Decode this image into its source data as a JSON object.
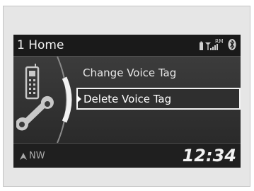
{
  "header": {
    "title": "1 Home"
  },
  "status": {
    "roaming_label": "RM"
  },
  "menu": {
    "items": [
      {
        "label": "Change Voice Tag",
        "selected": false
      },
      {
        "label": "Delete Voice Tag",
        "selected": true
      }
    ]
  },
  "footer": {
    "compass": "NW",
    "time": "12:34"
  },
  "icons": {
    "side": "phone-settings-icon",
    "battery": "battery-icon",
    "signal": "signal-icon",
    "bluetooth": "bluetooth-icon",
    "compass": "compass-arrow-icon"
  }
}
